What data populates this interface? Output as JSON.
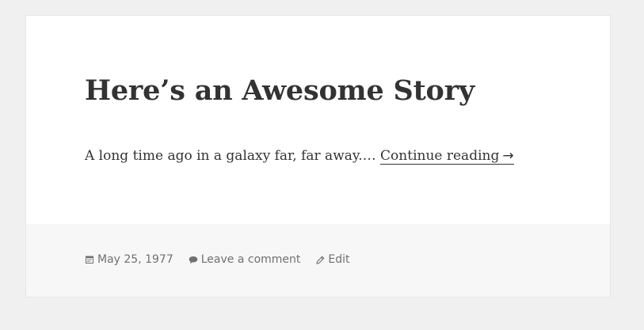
{
  "post": {
    "title": "Here’s an Awesome Story",
    "excerpt": "A long time ago in a galaxy far, far away.…",
    "continue_label": "Continue reading",
    "continue_arrow": "→"
  },
  "meta": {
    "date": "May 25, 1977",
    "comment_link": "Leave a comment",
    "edit_link": "Edit",
    "icons": [
      "calendar-icon",
      "comment-icon",
      "pencil-icon"
    ]
  }
}
